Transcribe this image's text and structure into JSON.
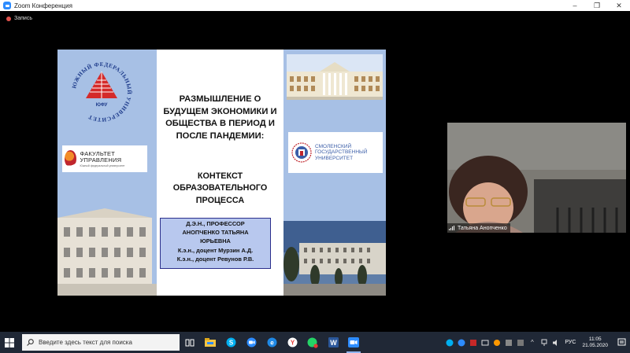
{
  "window": {
    "title": "Zoom Конференция",
    "minimize": "–",
    "restore": "❐",
    "close": "✕"
  },
  "recording": {
    "label": "Запись"
  },
  "slide": {
    "title": "РАЗМЫШЛЕНИЕ О БУДУЩЕМ ЭКОНОМИКИ И ОБЩЕСТВА В ПЕРИОД И ПОСЛЕ ПАНДЕМИИ:",
    "subtitle": "КОНТЕКСТ ОБРАЗОВАТЕЛЬНОГО ПРОЦЕССА",
    "authors": [
      "Д.Э.Н., ПРОФЕССОР",
      "АНОПЧЕНКО ТАТЬЯНА",
      "ЮРЬЕВНА",
      "К.э.н., доцент Мурзин А.Д.",
      "К.э.н., доцент Ревунов Р.В."
    ],
    "left_logo": {
      "ring_text": "ЮЖНЫЙ ФЕДЕРАЛЬНЫЙ УНИВЕРСИТЕТ",
      "abbr": "ЮФУ"
    },
    "faculty_logo": {
      "main": "ФАКУЛЬТЕТ УПРАВЛЕНИЯ",
      "sub": "Южный федеральный университет"
    },
    "smolensk_logo": {
      "lines": [
        "СМОЛЕНСКИЙ",
        "ГОСУДАРСТВЕННЫЙ",
        "УНИВЕРСИТЕТ"
      ]
    },
    "colors": {
      "panel": "#a7c0e5",
      "author_box": "#b8c8ee",
      "author_border": "#2b2f8c"
    }
  },
  "participant": {
    "name": "Татьяна Анопченко"
  },
  "taskbar": {
    "search_placeholder": "Введите здесь текст для поиска",
    "apps": [
      "task-view-icon",
      "file-explorer-icon",
      "skype-icon",
      "zoom-app-icon",
      "edge-icon",
      "yandex-icon",
      "whatsapp-icon",
      "word-icon",
      "zoom-active-icon"
    ],
    "language": "РУС",
    "time": "11:05",
    "date": "21.05.2020"
  }
}
